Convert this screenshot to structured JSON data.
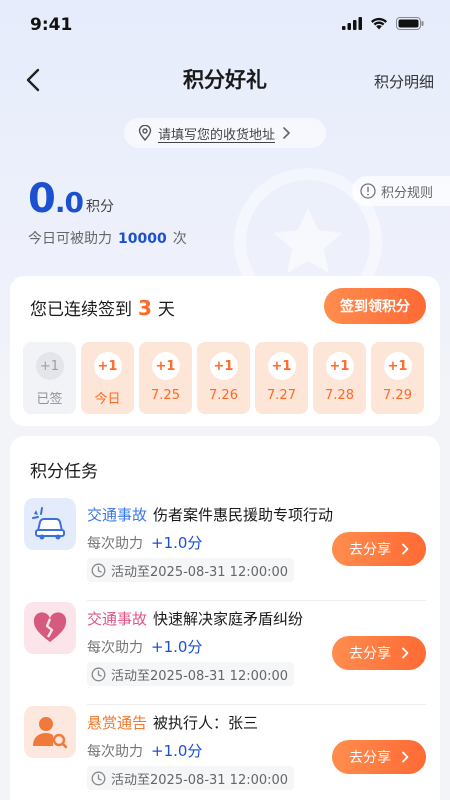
{
  "status_bar": {
    "time": "9:41"
  },
  "nav": {
    "title": "积分好礼",
    "detail_link": "积分明细"
  },
  "address": {
    "text": "请填写您的收货地址"
  },
  "rules": {
    "label": "积分规则"
  },
  "points": {
    "int_part": "0",
    "dec_part": ".0",
    "unit": "积分",
    "assist_prefix": "今日可被助力",
    "assist_count": "10000",
    "assist_suffix": "次"
  },
  "signin": {
    "title_prefix": "您已连续签到",
    "days": "3",
    "title_suffix": "天",
    "button": "签到领积分",
    "days_list": [
      {
        "points": "+1",
        "label": "已签",
        "state": "done"
      },
      {
        "points": "+1",
        "label": "今日",
        "state": "pending"
      },
      {
        "points": "+1",
        "label": "7.25",
        "state": "pending"
      },
      {
        "points": "+1",
        "label": "7.26",
        "state": "pending"
      },
      {
        "points": "+1",
        "label": "7.27",
        "state": "pending"
      },
      {
        "points": "+1",
        "label": "7.28",
        "state": "pending"
      },
      {
        "points": "+1",
        "label": "7.29",
        "state": "pending"
      }
    ]
  },
  "tasks": {
    "title": "积分任务",
    "items": [
      {
        "category": "交通事故",
        "category_color": "#3b78e7",
        "title": "伤者案件惠民援助专项行动",
        "assist_label": "每次助力",
        "assist_value": "+1.0分",
        "date": "活动至2025-08-31 12:00:00",
        "button": "去分享",
        "icon": "car-crash-icon"
      },
      {
        "category": "交通事故",
        "category_color": "#e0558a",
        "title": "快速解决家庭矛盾纠纷",
        "assist_label": "每次助力",
        "assist_value": "+1.0分",
        "date": "活动至2025-08-31 12:00:00",
        "button": "去分享",
        "icon": "broken-heart-icon"
      },
      {
        "category": "悬赏通告",
        "category_color": "#f07a2e",
        "title": "被执行人：张三",
        "assist_label": "每次助力",
        "assist_value": "+1.0分",
        "date": "活动至2025-08-31 12:00:00",
        "button": "去分享",
        "icon": "person-search-icon"
      }
    ]
  },
  "colors": {
    "accent_blue": "#1d4fd1",
    "accent_orange": "#ff6a2a"
  }
}
